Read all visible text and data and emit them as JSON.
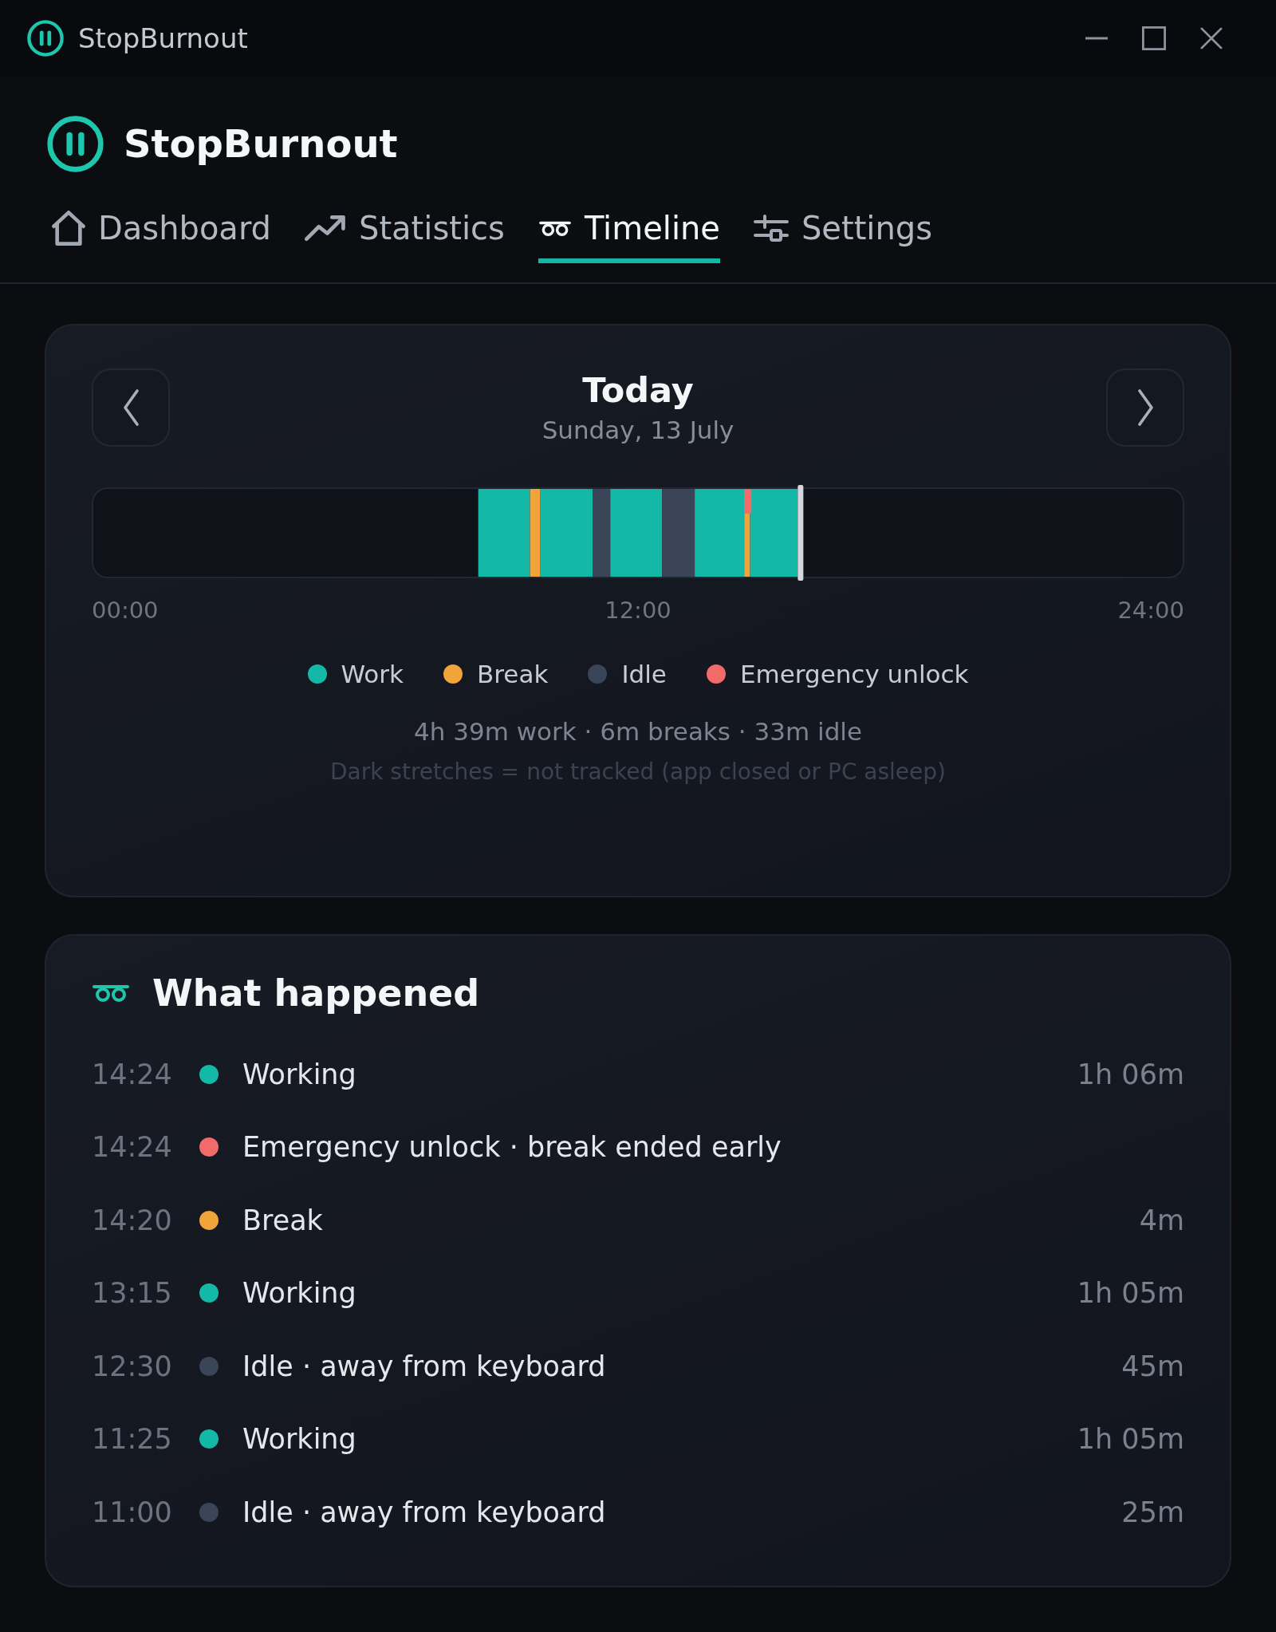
{
  "window": {
    "title": "StopBurnout"
  },
  "header": {
    "app_name": "StopBurnout"
  },
  "tabs": [
    {
      "label": "Dashboard",
      "kind": "dashboard",
      "selected": false
    },
    {
      "label": "Statistics",
      "kind": "statistics",
      "selected": false
    },
    {
      "label": "Timeline",
      "kind": "timeline",
      "selected": true
    },
    {
      "label": "Settings",
      "kind": "settings",
      "selected": false
    }
  ],
  "day": {
    "title": "Today",
    "date": "Sunday, 13 July"
  },
  "timeline": {
    "ticks": [
      "00:00",
      "12:00",
      "24:00"
    ]
  },
  "legend": [
    {
      "label": "Work",
      "color": "#14b8a6"
    },
    {
      "label": "Break",
      "color": "#f0a43a"
    },
    {
      "label": "Idle",
      "color": "#3b4558"
    },
    {
      "label": "Emergency unlock",
      "color": "#f26b6b"
    }
  ],
  "summary": "4h 39m work · 6m breaks · 33m idle",
  "note": "Dark stretches = not tracked (app closed or PC asleep)",
  "events": {
    "title": "What happened",
    "items": [
      {
        "time": "14:24",
        "label": "Working",
        "duration": "1h 06m",
        "color": "#14b8a6"
      },
      {
        "time": "14:24",
        "label": "Emergency unlock · break ended early",
        "color": "#f26b6b"
      },
      {
        "time": "14:20",
        "label": "Break",
        "duration": "4m",
        "color": "#f0a43a"
      },
      {
        "time": "13:15",
        "label": "Working",
        "duration": "1h 05m",
        "color": "#14b8a6"
      },
      {
        "time": "12:30",
        "label": "Idle · away from keyboard",
        "duration": "45m",
        "color": "#3b4558"
      },
      {
        "time": "11:25",
        "label": "Working",
        "duration": "1h 05m",
        "color": "#14b8a6"
      },
      {
        "time": "11:00",
        "label": "Idle · away from keyboard",
        "duration": "25m",
        "color": "#3b4558"
      }
    ]
  }
}
